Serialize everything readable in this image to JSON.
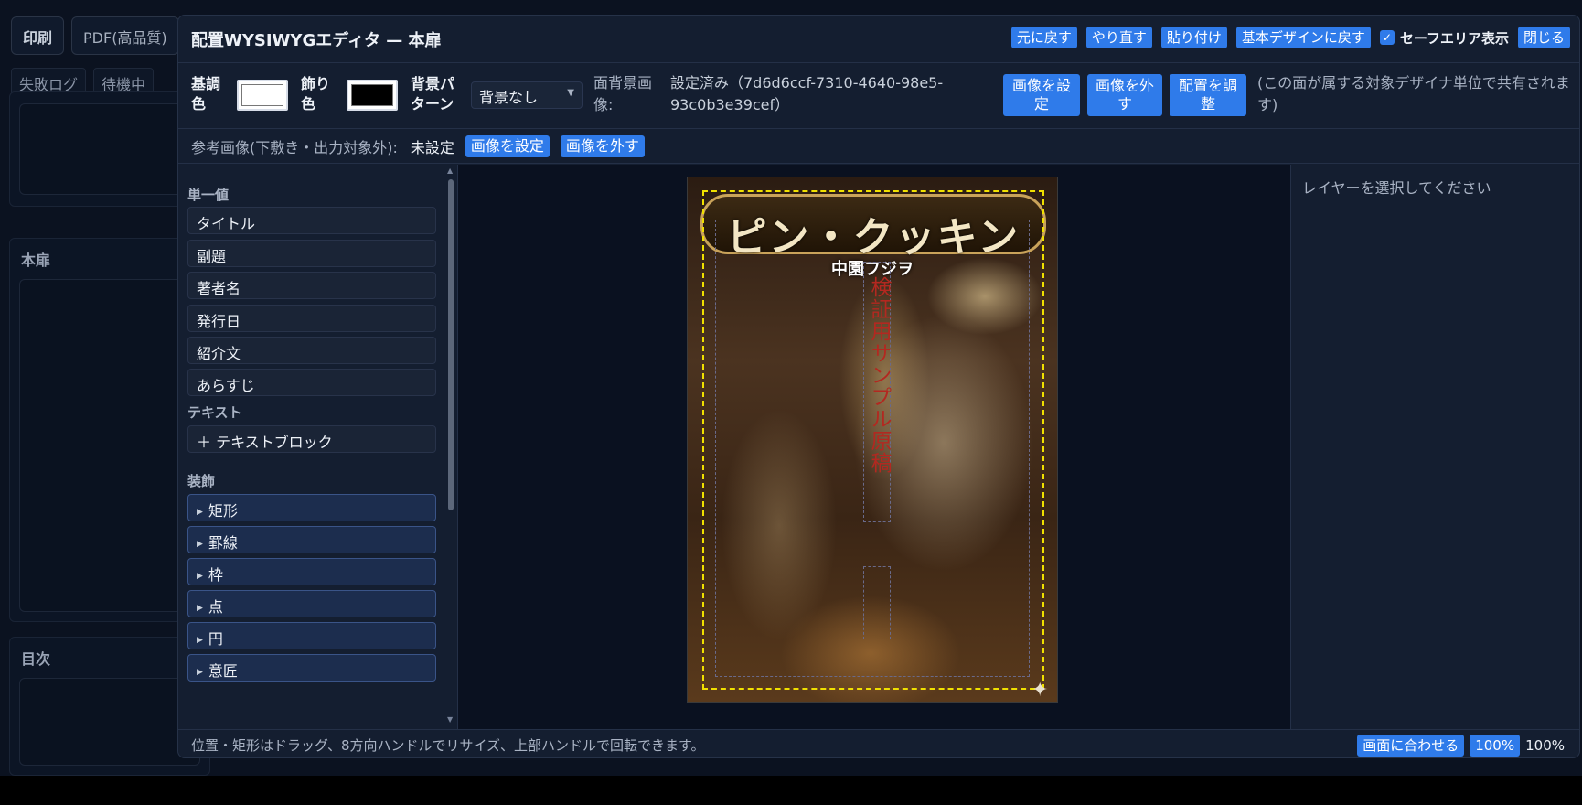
{
  "background": {
    "toolbar": {
      "print_label": "印刷",
      "pdf_label": "PDF(高品質)"
    },
    "tabs": [
      "失敗ログ",
      "待機中"
    ],
    "panels": {
      "honto": "本扉",
      "mokuji": "目次"
    }
  },
  "modal": {
    "title": "配置WYSIWYGエディタ — 本扉",
    "actions": {
      "undo": "元に戻す",
      "redo": "やり直す",
      "paste": "貼り付け",
      "reset_design": "基本デザインに戻す",
      "safe_area": "セーフエリア表示",
      "safe_area_checked": true,
      "close": "閉じる"
    },
    "colors": {
      "base_label": "基調色",
      "base_value": "#ffffff",
      "accent_label": "飾り色",
      "accent_value": "#000000",
      "pattern_label": "背景パターン",
      "pattern_value": "背景なし"
    },
    "bg_image": {
      "label": "面背景画像:",
      "value": "設定済み（7d6d6ccf-7310-4640-98e5-93c0b3e39cef）",
      "set_button": "画像を設定",
      "remove_button": "画像を外す",
      "adjust_button": "配置を調整",
      "note": "(この面が属する対象デザイナ単位で共有されます)"
    },
    "reference": {
      "label": "参考画像(下敷き・出力対象外):",
      "status": "未設定",
      "set_button": "画像を設定",
      "remove_button": "画像を外す"
    },
    "palette": {
      "single_section": "単一値",
      "single_items": [
        "タイトル",
        "副題",
        "著者名",
        "発行日",
        "紹介文",
        "あらすじ"
      ],
      "text_section": "テキスト",
      "text_item": "＋ テキストブロック",
      "deco_section": "装飾",
      "deco_items": [
        "矩形",
        "罫線",
        "枠",
        "点",
        "円",
        "意匠"
      ]
    },
    "cover": {
      "title": "ピン・クッキン",
      "author": "中園フジヲ",
      "sample_text": "検証用サンプル原稿"
    },
    "right_panel": {
      "placeholder": "レイヤーを選択してください"
    },
    "status": {
      "hint": "位置・矩形はドラッグ、8方向ハンドルでリサイズ、上部ハンドルで回転できます。",
      "fit_button": "画面に合わせる",
      "zoom_button": "100%",
      "zoom_value": "100%"
    }
  }
}
